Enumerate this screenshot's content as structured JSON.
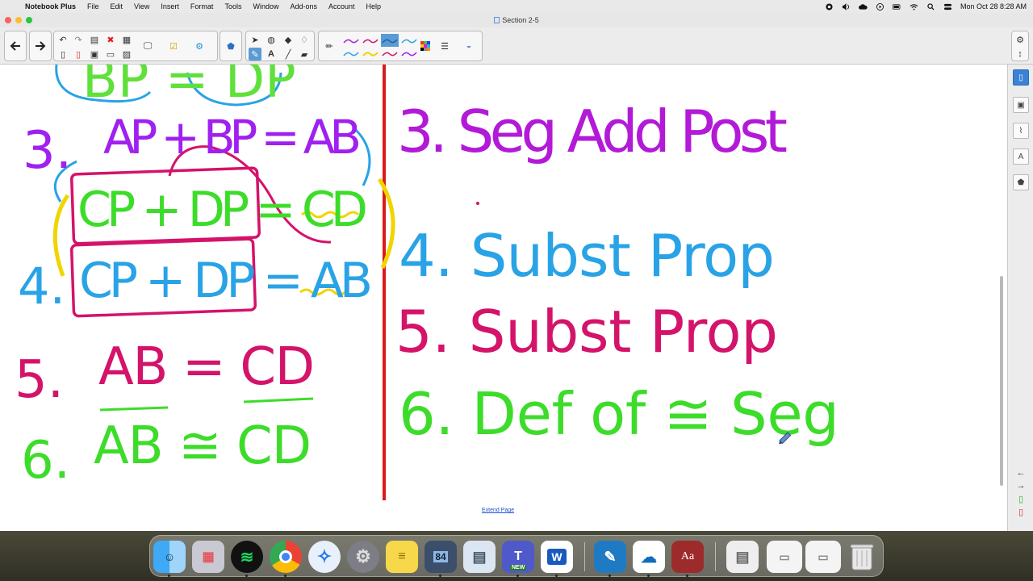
{
  "menubar": {
    "app_name": "Notebook Plus",
    "items": [
      "File",
      "Edit",
      "View",
      "Insert",
      "Format",
      "Tools",
      "Window",
      "Add-ons",
      "Account",
      "Help"
    ],
    "datetime": "Mon Oct 28  8:28 AM"
  },
  "window": {
    "title": "Section 2-5"
  },
  "canvas": {
    "extend_link": "Extend Page",
    "divider_color": "#d81b1b",
    "left_column": [
      {
        "text": "BP = DP",
        "color": "#5fe03a"
      },
      {
        "text": "3.",
        "color": "#a020f0"
      },
      {
        "text": "AP + BP = AB",
        "color": "#a020f0"
      },
      {
        "text": "CP + DP = CD",
        "color": "#3ddc2a"
      },
      {
        "text": "4.",
        "color": "#29a3e6"
      },
      {
        "text": "CP + DP = AB",
        "color": "#29a3e6"
      },
      {
        "text": "5.",
        "color": "#d4136a"
      },
      {
        "text": "AB = CD",
        "color": "#d4136a"
      },
      {
        "text": "6.",
        "color": "#3ddc2a"
      },
      {
        "text": "AB ≅ CD",
        "color": "#3ddc2a"
      }
    ],
    "right_column": [
      {
        "text": "3. Seg Add Post",
        "color": "#b21ad8"
      },
      {
        "text": "4. Subst Prop",
        "color": "#29a3e6"
      },
      {
        "text": "5. Subst Prop",
        "color": "#d4136a"
      },
      {
        "text": "6. Def of ≅ Seg",
        "color": "#3ddc2a"
      }
    ]
  },
  "dock": {
    "apps": [
      "Finder",
      "Launchpad",
      "Spotify",
      "Chrome",
      "Safari",
      "System Settings",
      "Stickies",
      "Calculator 84",
      "Preview",
      "Teams",
      "Word",
      "Notebook",
      "OneDrive",
      "Dictionary",
      "Documents",
      "Trash"
    ],
    "teams_badge": "NEW",
    "dictionary_label": "Aa",
    "word_label": "W",
    "calc_label": "84"
  }
}
